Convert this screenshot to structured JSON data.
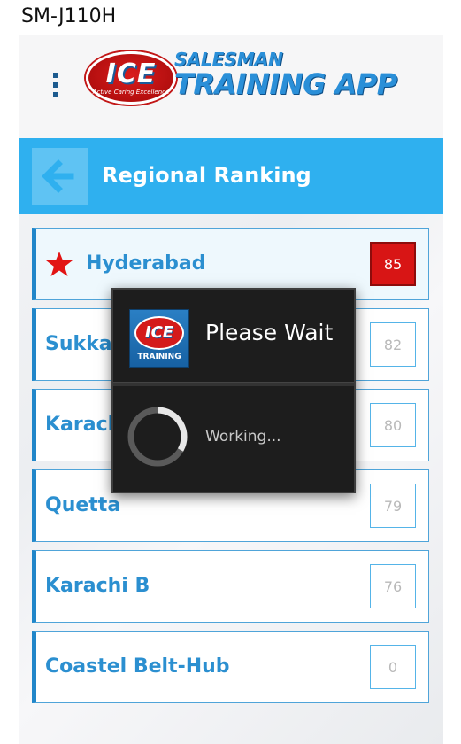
{
  "device": {
    "label": "SM-J110H"
  },
  "header": {
    "logo_big": "ICE",
    "logo_small": "Active Caring Excellence",
    "title_line1": "SALESMAN",
    "title_line2": "TRAINING APP"
  },
  "titlebar": {
    "title": "Regional Ranking"
  },
  "rankings": [
    {
      "name": "Hyderabad",
      "score": "85",
      "highlight": true
    },
    {
      "name": "Sukkar",
      "score": "82"
    },
    {
      "name": "Karachi A",
      "score": "80"
    },
    {
      "name": "Quetta",
      "score": "79"
    },
    {
      "name": "Karachi B",
      "score": "76"
    },
    {
      "name": "Coastel Belt-Hub",
      "score": "0"
    }
  ],
  "dialog": {
    "title": "Please Wait",
    "message": "Working...",
    "icon_text": "ICE",
    "icon_caption": "TRAINING"
  },
  "colors": {
    "accent": "#2fb0ef",
    "list_text": "#2b8fd0",
    "top_score": "#d81515",
    "dialog_bg": "#1d1d1d"
  }
}
